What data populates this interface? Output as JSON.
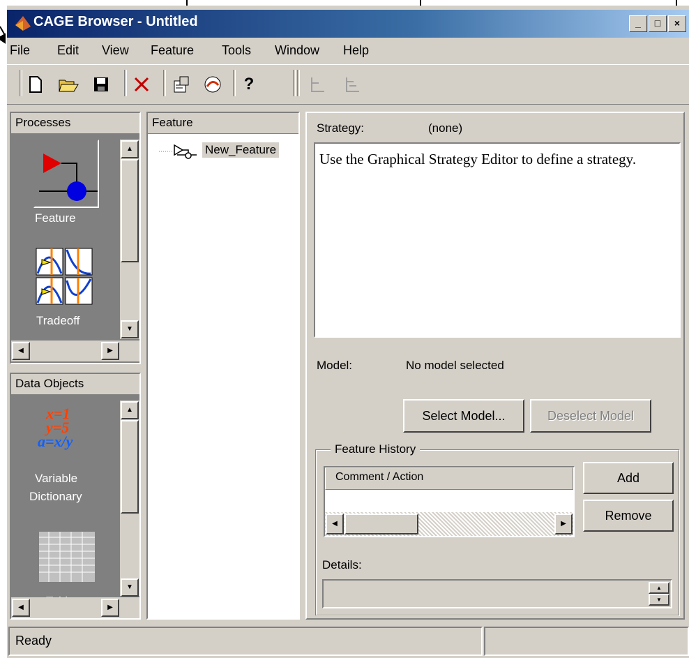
{
  "window": {
    "title": "CAGE Browser - Untitled"
  },
  "menu": [
    "File",
    "Edit",
    "View",
    "Feature",
    "Tools",
    "Window",
    "Help"
  ],
  "processes": {
    "header": "Processes",
    "items": [
      {
        "label": "Feature"
      },
      {
        "label": "Tradeoff"
      }
    ]
  },
  "data_objects": {
    "header": "Data Objects",
    "var_dict": {
      "line1": "x=1",
      "line2": "y=5",
      "line3": "a=x/y",
      "label1": "Variable",
      "label2": "Dictionary"
    },
    "tables": {
      "label": "Tables"
    }
  },
  "feature_tree": {
    "header": "Feature",
    "node": "New_Feature"
  },
  "strategy": {
    "label": "Strategy:",
    "value": "(none)",
    "text": "Use the Graphical Strategy Editor to define a strategy."
  },
  "model": {
    "label": "Model:",
    "value": "No model selected"
  },
  "buttons": {
    "select_model": "Select Model...",
    "deselect_model": "Deselect Model",
    "add": "Add",
    "remove": "Remove"
  },
  "history": {
    "group_title": "Feature History",
    "column": "Comment / Action"
  },
  "details": {
    "label": "Details:"
  },
  "status": {
    "text": "Ready"
  }
}
